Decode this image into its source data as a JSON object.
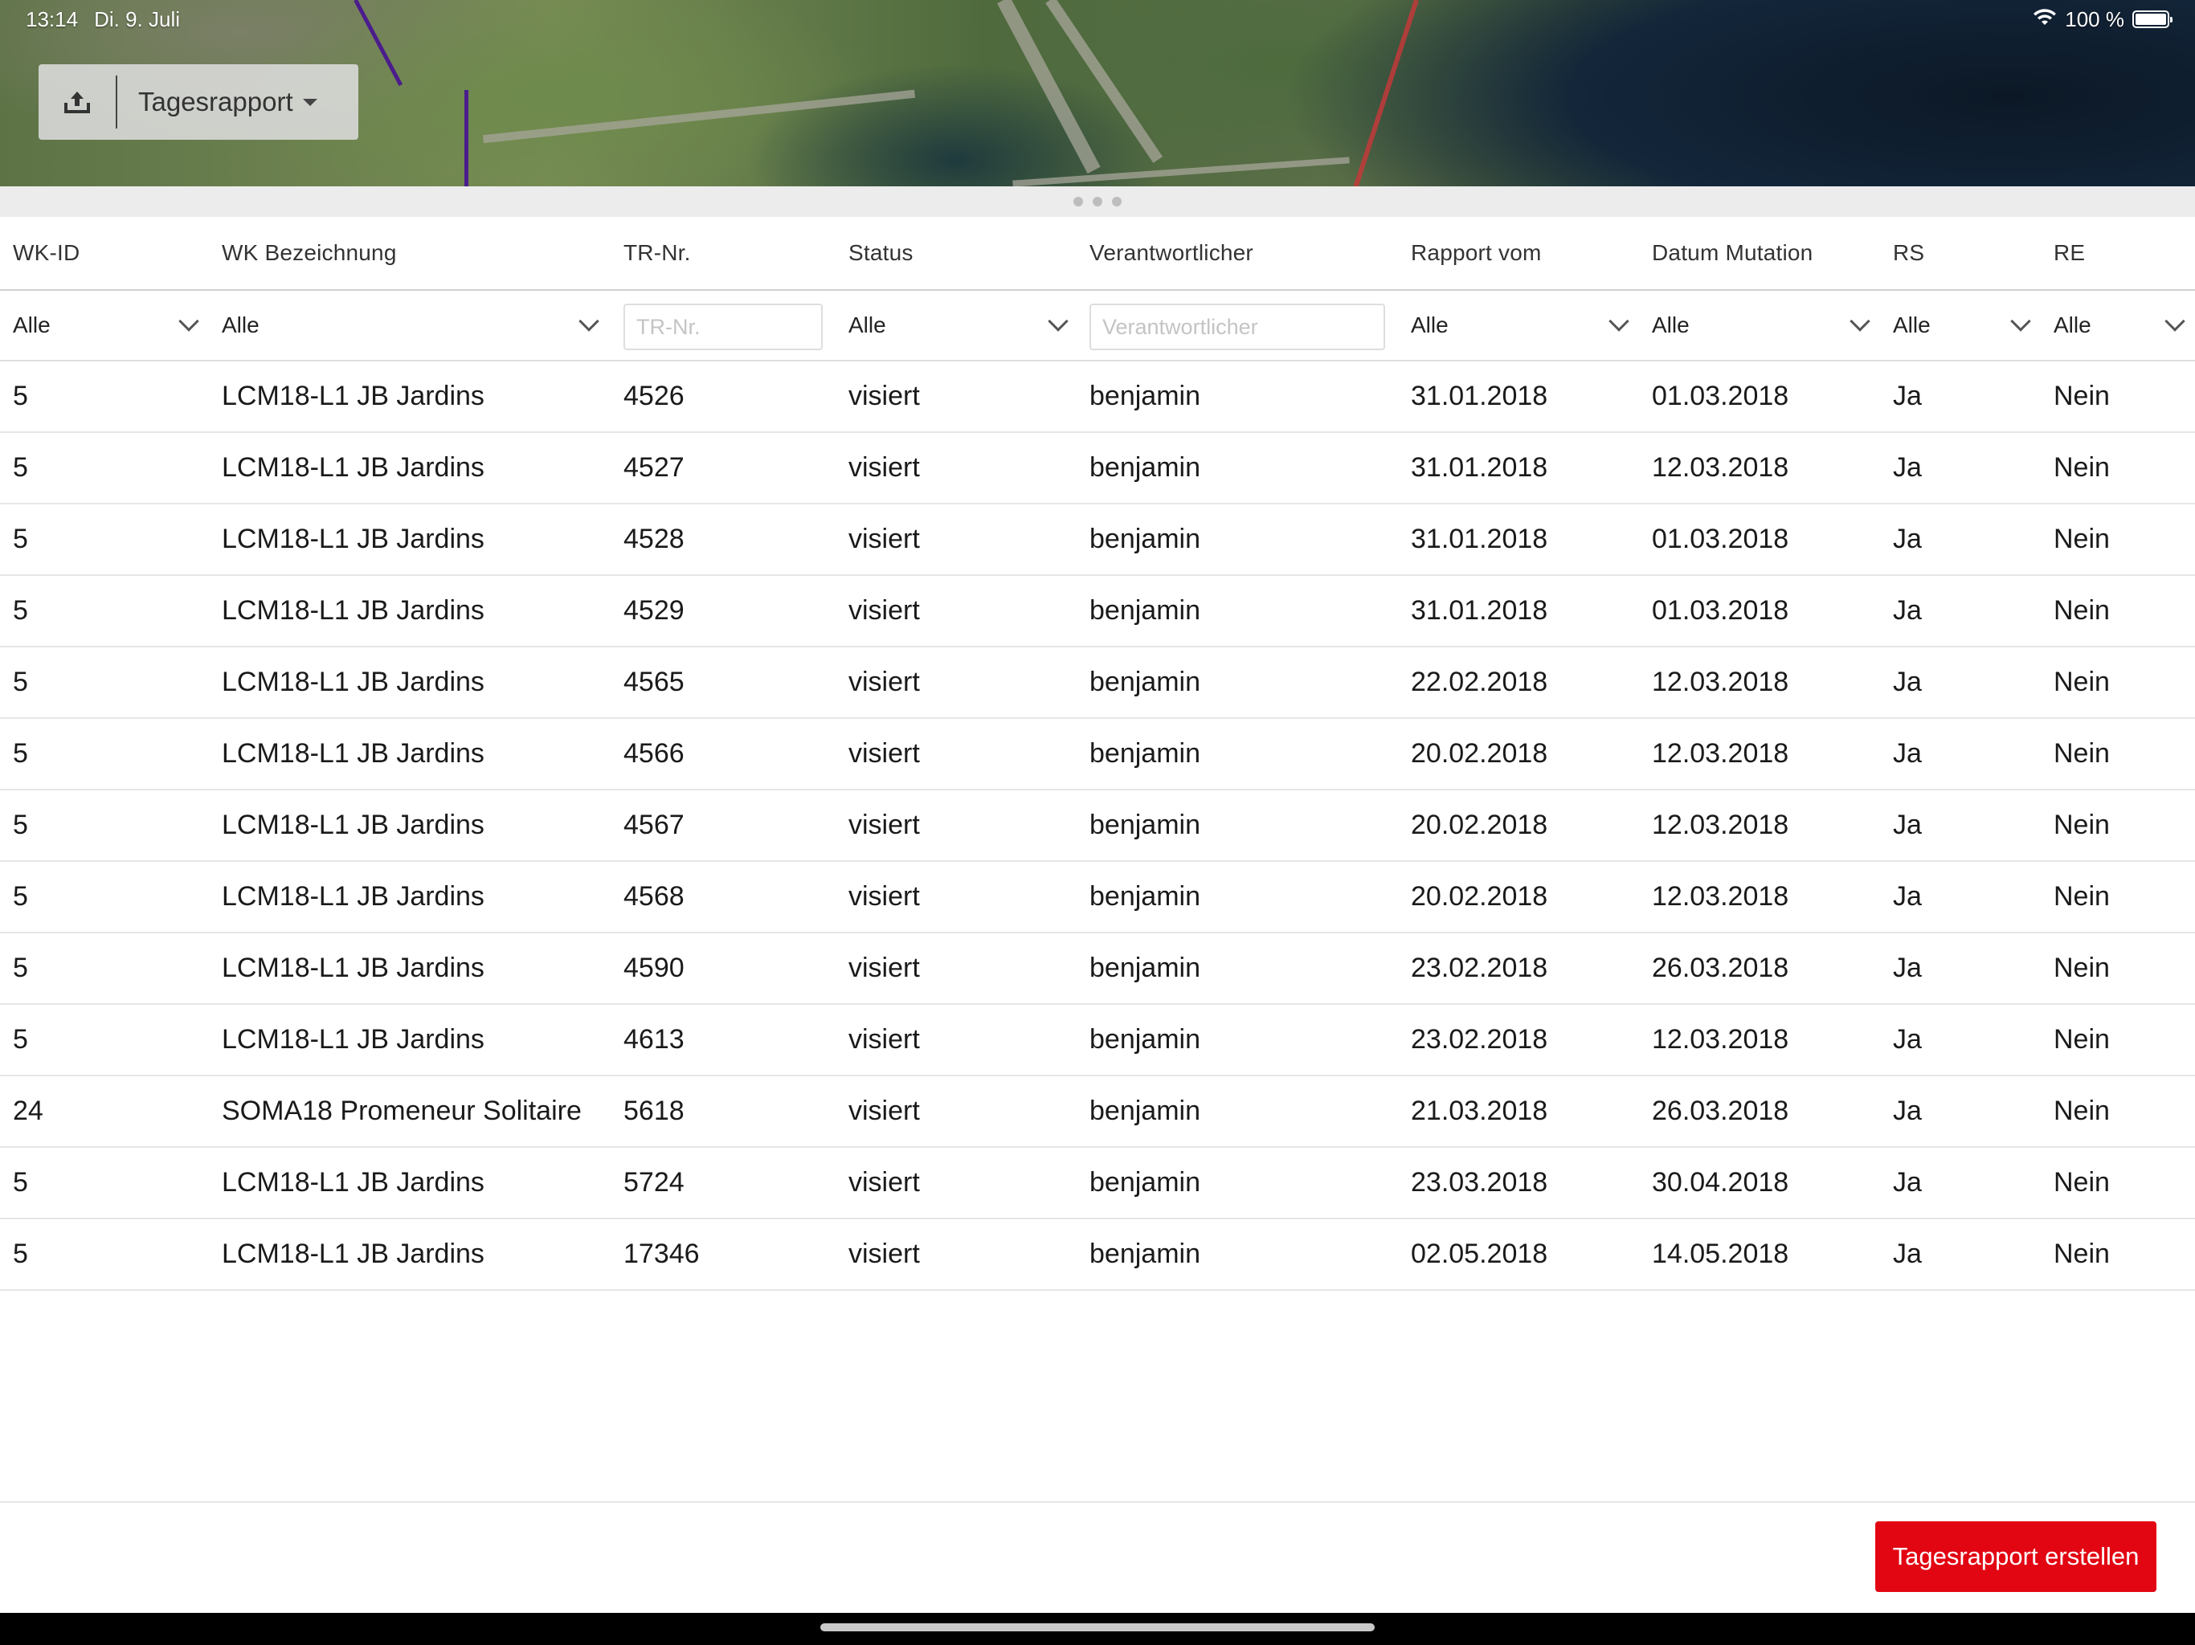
{
  "status_bar": {
    "time": "13:14",
    "date": "Di. 9. Juli",
    "battery": "100 %"
  },
  "toolbar": {
    "dropdown_label": "Tagesrapport"
  },
  "table": {
    "columns": [
      {
        "key": "wk_id",
        "label": "WK-ID"
      },
      {
        "key": "wk_bez",
        "label": "WK Bezeichnung"
      },
      {
        "key": "tr_nr",
        "label": "TR-Nr."
      },
      {
        "key": "status",
        "label": "Status"
      },
      {
        "key": "verantw",
        "label": "Verantwortlicher"
      },
      {
        "key": "rapport",
        "label": "Rapport vom"
      },
      {
        "key": "mutation",
        "label": "Datum Mutation"
      },
      {
        "key": "rs",
        "label": "RS"
      },
      {
        "key": "re",
        "label": "RE"
      }
    ],
    "filters": {
      "wk_id": "Alle",
      "wk_bez": "Alle",
      "tr_nr_placeholder": "TR-Nr.",
      "status": "Alle",
      "verantw_placeholder": "Verantwortlicher",
      "rapport": "Alle",
      "mutation": "Alle",
      "rs": "Alle",
      "re": "Alle"
    },
    "rows": [
      [
        "5",
        "LCM18-L1 JB Jardins",
        "4526",
        "visiert",
        "benjamin",
        "31.01.2018",
        "01.03.2018",
        "Ja",
        "Nein"
      ],
      [
        "5",
        "LCM18-L1 JB Jardins",
        "4527",
        "visiert",
        "benjamin",
        "31.01.2018",
        "12.03.2018",
        "Ja",
        "Nein"
      ],
      [
        "5",
        "LCM18-L1 JB Jardins",
        "4528",
        "visiert",
        "benjamin",
        "31.01.2018",
        "01.03.2018",
        "Ja",
        "Nein"
      ],
      [
        "5",
        "LCM18-L1 JB Jardins",
        "4529",
        "visiert",
        "benjamin",
        "31.01.2018",
        "01.03.2018",
        "Ja",
        "Nein"
      ],
      [
        "5",
        "LCM18-L1 JB Jardins",
        "4565",
        "visiert",
        "benjamin",
        "22.02.2018",
        "12.03.2018",
        "Ja",
        "Nein"
      ],
      [
        "5",
        "LCM18-L1 JB Jardins",
        "4566",
        "visiert",
        "benjamin",
        "20.02.2018",
        "12.03.2018",
        "Ja",
        "Nein"
      ],
      [
        "5",
        "LCM18-L1 JB Jardins",
        "4567",
        "visiert",
        "benjamin",
        "20.02.2018",
        "12.03.2018",
        "Ja",
        "Nein"
      ],
      [
        "5",
        "LCM18-L1 JB Jardins",
        "4568",
        "visiert",
        "benjamin",
        "20.02.2018",
        "12.03.2018",
        "Ja",
        "Nein"
      ],
      [
        "5",
        "LCM18-L1 JB Jardins",
        "4590",
        "visiert",
        "benjamin",
        "23.02.2018",
        "26.03.2018",
        "Ja",
        "Nein"
      ],
      [
        "5",
        "LCM18-L1 JB Jardins",
        "4613",
        "visiert",
        "benjamin",
        "23.02.2018",
        "12.03.2018",
        "Ja",
        "Nein"
      ],
      [
        "24",
        "SOMA18 Promeneur Solitaire",
        "5618",
        "visiert",
        "benjamin",
        "21.03.2018",
        "26.03.2018",
        "Ja",
        "Nein"
      ],
      [
        "5",
        "LCM18-L1 JB Jardins",
        "5724",
        "visiert",
        "benjamin",
        "23.03.2018",
        "30.04.2018",
        "Ja",
        "Nein"
      ],
      [
        "5",
        "LCM18-L1 JB Jardins",
        "17346",
        "visiert",
        "benjamin",
        "02.05.2018",
        "14.05.2018",
        "Ja",
        "Nein"
      ]
    ]
  },
  "footer": {
    "create_button": "Tagesrapport erstellen"
  },
  "colors": {
    "accent": "#e20613"
  }
}
